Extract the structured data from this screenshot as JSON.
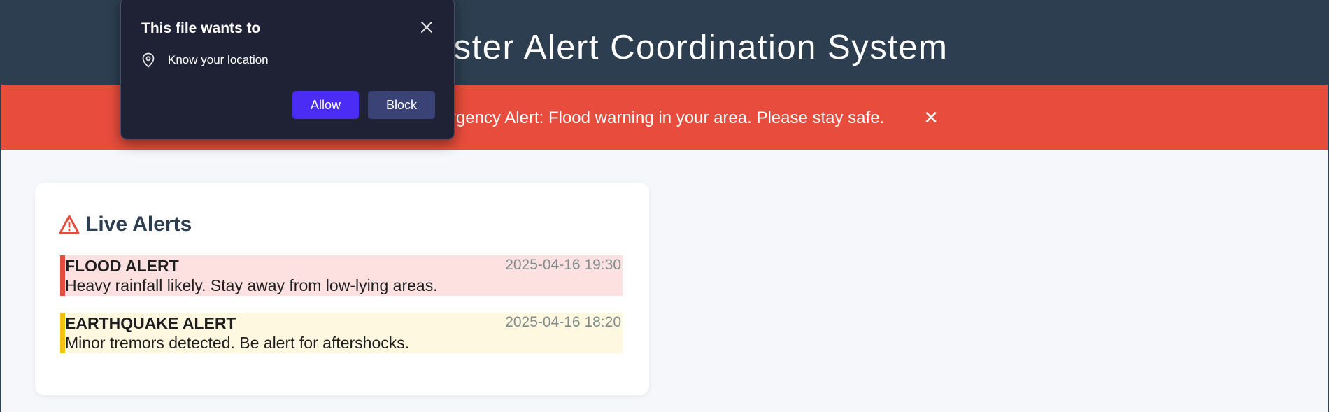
{
  "header": {
    "title": "Disaster Alert Coordination System"
  },
  "banner": {
    "text": "⚠️ Emergency Alert: Flood warning in your area. Please stay safe.",
    "close_label": "✕"
  },
  "live_alerts": {
    "title": "Live Alerts",
    "items": [
      {
        "title": "FLOOD ALERT",
        "time": "2025-04-16 19:30",
        "message": "Heavy rainfall likely. Stay away from low-lying areas.",
        "color": "#e74c3c"
      },
      {
        "title": "EARTHQUAKE ALERT",
        "time": "2025-04-16 18:20",
        "message": "Minor tremors detected. Be alert for aftershocks.",
        "color": "#f1c40f"
      }
    ]
  },
  "permission_popup": {
    "title": "This file wants to",
    "permission": "Know your location",
    "permission_icon": "location-pin-icon",
    "allow_label": "Allow",
    "block_label": "Block"
  },
  "colors": {
    "header_bg": "#2c3e50",
    "banner_bg": "#e74c3c",
    "allow_bg": "#4b2cf5",
    "block_bg": "#3b4376"
  }
}
